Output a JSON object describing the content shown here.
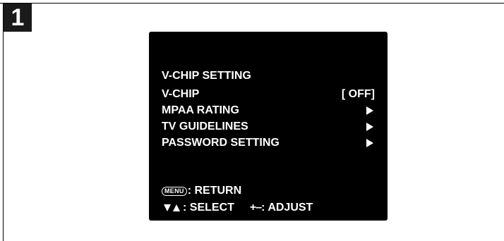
{
  "step": {
    "number": "1"
  },
  "menu": {
    "title": "V-CHIP SETTING",
    "items": [
      {
        "label": "V-CHIP",
        "value": "[ OFF]",
        "icon": "arrow-right-icon"
      },
      {
        "label": "MPAA RATING",
        "icon": "arrow-right-icon"
      },
      {
        "label": "TV GUIDELINES",
        "icon": "arrow-right-icon"
      },
      {
        "label": "PASSWORD SETTING",
        "icon": "arrow-right-icon"
      }
    ]
  },
  "footer": {
    "menu_key": "MENU",
    "return_label": ": RETURN",
    "select_label": ": SELECT",
    "adjust_symbol": "+–",
    "adjust_label": ": ADJUST"
  },
  "colors": {
    "screen_bg": "#000000",
    "text": "#ffffff",
    "badge_bg": "#1a1a1a",
    "page_bg": "#ffffff"
  }
}
